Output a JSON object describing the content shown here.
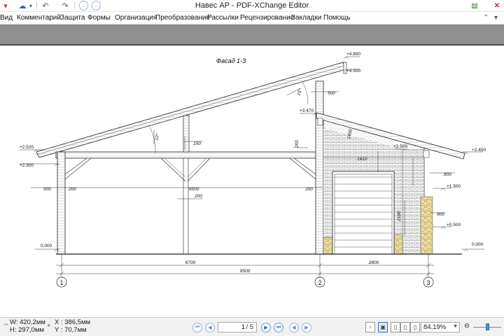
{
  "window": {
    "title": "Навес АР - PDF-XChange Editor",
    "close_glyph": "✕"
  },
  "quick_access": [
    {
      "icon": "undo-icon",
      "glyph": "↶"
    },
    {
      "icon": "redo-icon",
      "glyph": "↷"
    },
    {
      "icon": "back-icon",
      "glyph": "←"
    },
    {
      "icon": "forward-icon",
      "glyph": "→"
    }
  ],
  "menu": [
    "Вид",
    "Комментарий",
    "Защита",
    "Формы",
    "Организация",
    "Преобразование",
    "Рассылки",
    "Рецензирование",
    "Закладки",
    "Помощь"
  ],
  "drawing": {
    "title": "Фасад 1-3",
    "levels": {
      "top_ridge": "+4.890",
      "top_beam": "+4.500",
      "left_eave": "+2.520",
      "left_beam": "+2.500",
      "mid_wall": "+3.470",
      "right_inner": "+2.500",
      "right_eave": "+2.450",
      "right_1500": "+1.500",
      "right_0500": "+0.500",
      "ground_left": "0.000",
      "ground_right": "0.000"
    },
    "dims": {
      "d500_top": "500",
      "d500_left": "500",
      "d200_a": "200",
      "d200_b": "200",
      "d200_c": "200",
      "d200_d": "200",
      "d6500": "6500",
      "d150": "150",
      "d1610": "1610",
      "d1400": "1400",
      "d2180": "2180",
      "d800": "800",
      "d900": "900",
      "d6700": "6700",
      "d2800": "2800",
      "d9500": "9500",
      "angle_left": "12°",
      "angle_right": "15°"
    },
    "axes": [
      "1",
      "2",
      "3"
    ]
  },
  "status": {
    "width_label": "W: 420,2мм",
    "height_label": "H: 297,0мм",
    "x_label": "X : 386,5мм",
    "y_label": "Y :   70,7мм",
    "current_page": "1",
    "total_pages": "/ 5",
    "zoom": "84,19%"
  }
}
